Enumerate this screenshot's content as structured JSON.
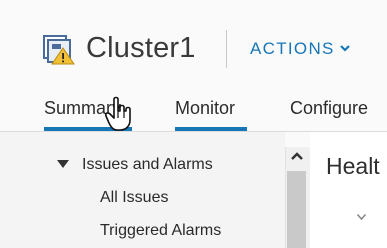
{
  "header": {
    "title": "Cluster1",
    "actions_label": "ACTIONS",
    "icon": "cluster-warning-icon"
  },
  "tabs": [
    {
      "label": "Summary",
      "active": true
    },
    {
      "label": "Monitor",
      "active": true
    },
    {
      "label": "Configure",
      "active": false
    }
  ],
  "tree": {
    "group_label": "Issues and Alarms",
    "items": [
      {
        "label": "All Issues"
      },
      {
        "label": "Triggered Alarms"
      }
    ]
  },
  "content": {
    "title": "Healt"
  },
  "cursor": "hand-pointer-icon",
  "colors": {
    "accent": "#1676b6",
    "warning": "#f2c037",
    "pane_background": "#f4f4f4"
  }
}
